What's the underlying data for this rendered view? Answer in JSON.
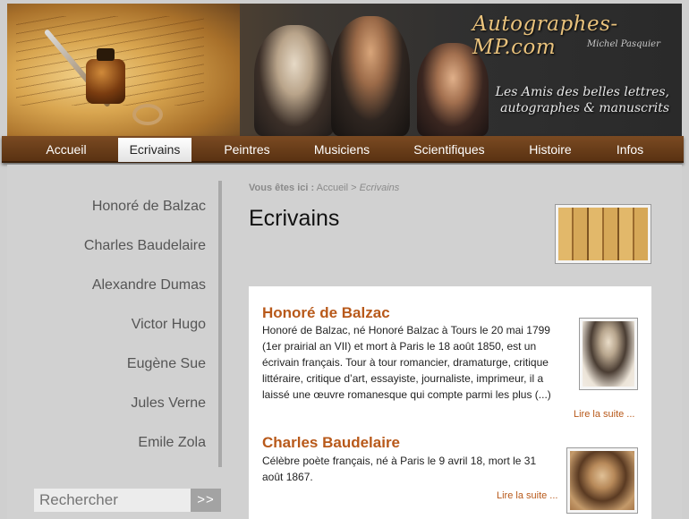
{
  "header": {
    "logo": "Autographes-MP.com",
    "signature": "Michel Pasquier",
    "tagline_line1": "Les Amis des belles lettres,",
    "tagline_line2": "autographes & manuscrits"
  },
  "nav": {
    "items": [
      {
        "label": "Accueil"
      },
      {
        "label": "Ecrivains"
      },
      {
        "label": "Peintres"
      },
      {
        "label": "Musiciens"
      },
      {
        "label": "Scientifiques"
      },
      {
        "label": "Histoire"
      },
      {
        "label": "Infos"
      }
    ],
    "active": "Ecrivains"
  },
  "sidebar": {
    "items": [
      {
        "label": "Honoré de Balzac"
      },
      {
        "label": "Charles Baudelaire"
      },
      {
        "label": "Alexandre Dumas"
      },
      {
        "label": "Victor Hugo"
      },
      {
        "label": "Eugène Sue"
      },
      {
        "label": "Jules Verne"
      },
      {
        "label": "Emile Zola"
      }
    ]
  },
  "search": {
    "placeholder": "Rechercher",
    "button_label": ">>"
  },
  "breadcrumb": {
    "label": "Vous êtes ici :",
    "home": "Accueil",
    "separator": ">",
    "current": "Ecrivains"
  },
  "main": {
    "title": "Ecrivains",
    "articles": [
      {
        "title": "Honoré de Balzac",
        "lines": [
          "Honoré de Balzac, né Honoré Balzac à Tours le 20 mai 1799",
          "(1er prairial an VII) et mort à Paris le 18 août 1850, est un",
          "écrivain français. Tour à tour romancier, dramaturge, critique",
          "littéraire, critique d’art, essayiste, journaliste, imprimeur, il a",
          "laissé une œuvre romanesque qui compte parmi les plus (...)"
        ],
        "read_more": "Lire la suite ..."
      },
      {
        "title": "Charles Baudelaire",
        "lines": [
          "Célèbre poète français, né à Paris le 9 avril 18, mort le 31",
          "août 1867."
        ],
        "read_more": "Lire la suite ..."
      }
    ]
  }
}
